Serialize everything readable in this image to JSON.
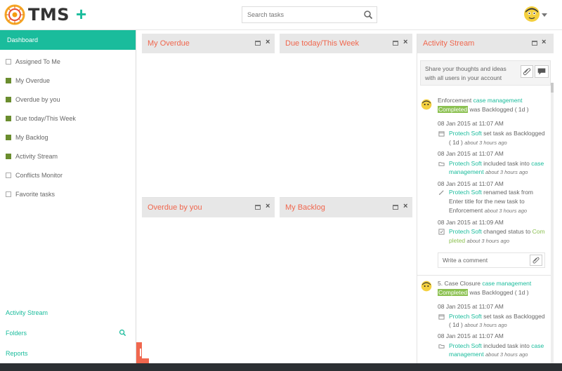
{
  "app": {
    "logo_text": "TMS",
    "search_placeholder": "Search tasks"
  },
  "sidebar": {
    "dashboard": "Dashboard",
    "items": [
      {
        "label": "Assigned To Me",
        "checked": false
      },
      {
        "label": "My Overdue",
        "checked": true
      },
      {
        "label": "Overdue by you",
        "checked": true
      },
      {
        "label": "Due today/This Week",
        "checked": true
      },
      {
        "label": "My Backlog",
        "checked": true
      },
      {
        "label": "Activity Stream",
        "checked": true
      },
      {
        "label": "Conflicts Monitor",
        "checked": false
      },
      {
        "label": "Favorite tasks",
        "checked": false
      }
    ],
    "bottom": {
      "activity_stream": "Activity Stream",
      "folders": "Folders",
      "reports": "Reports"
    }
  },
  "widgets": {
    "my_overdue": "My Overdue",
    "due_today": "Due today/This Week",
    "activity_stream": "Activity Stream",
    "overdue_by_you": "Overdue by you",
    "my_backlog": "My Backlog"
  },
  "activity": {
    "share_placeholder": "Share your thoughts and ideas with all users in your account",
    "write_comment": "Write a comment",
    "entry1": {
      "prefix": "Enforcement",
      "project": "case management",
      "status": "Completed",
      "suffix": "was Backlogged ( 1d )",
      "events": [
        {
          "date": "08 Jan 2015 at 11:07 AM",
          "user": "Protech Soft",
          "line1": "set task as Backlogged",
          "line2": "( 1d )",
          "ago": "about 3 hours ago"
        },
        {
          "date": "08 Jan 2015 at 11:07 AM",
          "user": "Protech Soft",
          "line1": "included task into",
          "project1": "case",
          "project2": "management",
          "ago": "about 3 hours ago"
        },
        {
          "date": "08 Jan 2015 at 11:07 AM",
          "user": "Protech Soft",
          "line1": "renamed task from",
          "line2": "Enter title for the new task to",
          "line3": "Enforcement",
          "ago": "about 3 hours ago"
        },
        {
          "date": "08 Jan 2015 at 11:09 AM",
          "user": "Protech Soft",
          "line1": "changed status to",
          "status1": "Com",
          "status2": "pleted",
          "ago": "about 3 hours ago"
        }
      ]
    },
    "entry2": {
      "prefix": "5. Case Closure",
      "project": "case management",
      "status": "Completed",
      "suffix": "was Backlogged ( 1d )",
      "events": [
        {
          "date": "08 Jan 2015 at 11:07 AM",
          "user": "Protech Soft",
          "line1": "set task as Backlogged",
          "line2": "( 1d )",
          "ago": "about 3 hours ago"
        },
        {
          "date": "08 Jan 2015 at 11:07 AM",
          "user": "Protech Soft",
          "line1": "included task into",
          "project1": "case",
          "project2": "management",
          "ago": "about 3 hours ago"
        }
      ]
    }
  },
  "colors": {
    "accent": "#1abc9c",
    "title_red": "#f0674e",
    "check_green": "#6a8d2e",
    "status_green": "#8cc152"
  }
}
